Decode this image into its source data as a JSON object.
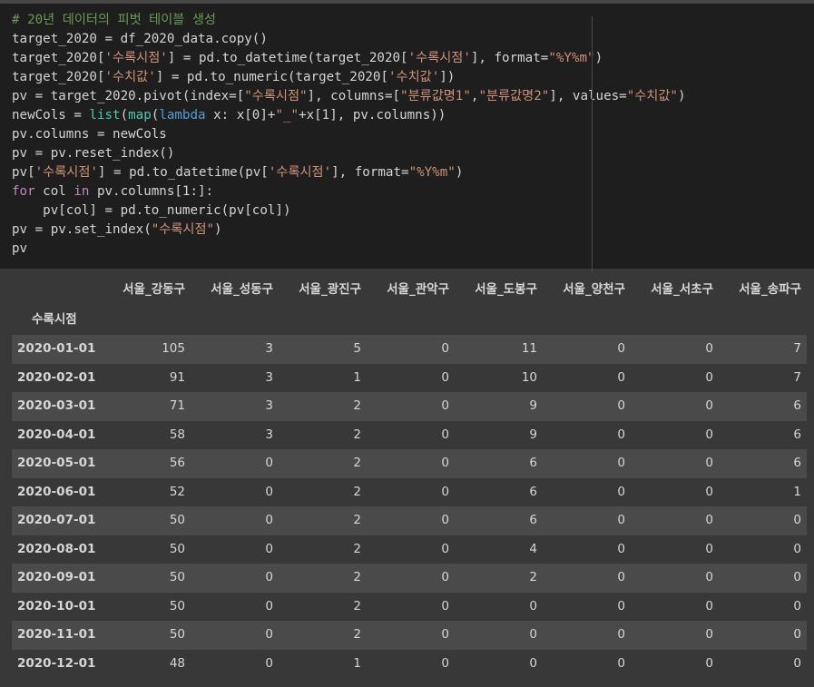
{
  "code_cell": {
    "lines": [
      [
        {
          "t": "# 20년 데이터의 피벗 테이블 생성",
          "c": "c-comment"
        }
      ],
      [
        {
          "t": "target_2020 = df_2020_data.copy()",
          "c": ""
        }
      ],
      [
        {
          "t": "target_2020[",
          "c": ""
        },
        {
          "t": "'수록시점'",
          "c": "c-str"
        },
        {
          "t": "] = pd.to_datetime(target_2020[",
          "c": ""
        },
        {
          "t": "'수록시점'",
          "c": "c-str"
        },
        {
          "t": "], format=",
          "c": ""
        },
        {
          "t": "\"%Y%m\"",
          "c": "c-str"
        },
        {
          "t": ")",
          "c": ""
        }
      ],
      [
        {
          "t": "target_2020[",
          "c": ""
        },
        {
          "t": "'수치값'",
          "c": "c-str"
        },
        {
          "t": "] = pd.to_numeric(target_2020[",
          "c": ""
        },
        {
          "t": "'수치값'",
          "c": "c-str"
        },
        {
          "t": "])",
          "c": ""
        }
      ],
      [
        {
          "t": "pv = target_2020.pivot(index=[",
          "c": ""
        },
        {
          "t": "\"수록시점\"",
          "c": "c-str"
        },
        {
          "t": "], columns=[",
          "c": ""
        },
        {
          "t": "\"분류값명1\"",
          "c": "c-str"
        },
        {
          "t": ",",
          "c": ""
        },
        {
          "t": "\"분류값명2\"",
          "c": "c-str"
        },
        {
          "t": "], values=",
          "c": ""
        },
        {
          "t": "\"수치값\"",
          "c": "c-str"
        },
        {
          "t": ")",
          "c": ""
        }
      ],
      [
        {
          "t": "newCols = ",
          "c": ""
        },
        {
          "t": "list",
          "c": "c-builtin"
        },
        {
          "t": "(",
          "c": ""
        },
        {
          "t": "map",
          "c": "c-builtin"
        },
        {
          "t": "(",
          "c": ""
        },
        {
          "t": "lambda",
          "c": "c-lambda"
        },
        {
          "t": " x: x[0]+",
          "c": ""
        },
        {
          "t": "\"_\"",
          "c": "c-str"
        },
        {
          "t": "+x[1], pv.columns))",
          "c": ""
        }
      ],
      [
        {
          "t": "pv.columns = newCols",
          "c": ""
        }
      ],
      [
        {
          "t": "pv = pv.reset_index()",
          "c": ""
        }
      ],
      [
        {
          "t": "pv[",
          "c": ""
        },
        {
          "t": "'수록시점'",
          "c": "c-str"
        },
        {
          "t": "] = pd.to_datetime(pv[",
          "c": ""
        },
        {
          "t": "'수록시점'",
          "c": "c-str"
        },
        {
          "t": "], format=",
          "c": ""
        },
        {
          "t": "\"%Y%m\"",
          "c": "c-str"
        },
        {
          "t": ")",
          "c": ""
        }
      ],
      [
        {
          "t": "for",
          "c": "c-kw"
        },
        {
          "t": " col ",
          "c": ""
        },
        {
          "t": "in",
          "c": "c-kw"
        },
        {
          "t": " pv.columns[1:]:",
          "c": ""
        }
      ],
      [
        {
          "t": "    pv[col] = pd.to_numeric(pv[col])",
          "c": ""
        }
      ],
      [
        {
          "t": "pv = pv.set_index(",
          "c": ""
        },
        {
          "t": "\"수록시점\"",
          "c": "c-str"
        },
        {
          "t": ")",
          "c": ""
        }
      ],
      [
        {
          "t": "pv",
          "c": ""
        }
      ]
    ]
  },
  "output_table": {
    "index_name": "수록시점",
    "columns": [
      "서울_강동구",
      "서울_성동구",
      "서울_광진구",
      "서울_관악구",
      "서울_도봉구",
      "서울_양천구",
      "서울_서초구",
      "서울_송파구"
    ],
    "rows": [
      {
        "index": "2020-01-01",
        "values": [
          "105",
          "3",
          "5",
          "0",
          "11",
          "0",
          "0",
          "7"
        ]
      },
      {
        "index": "2020-02-01",
        "values": [
          "91",
          "3",
          "1",
          "0",
          "10",
          "0",
          "0",
          "7"
        ]
      },
      {
        "index": "2020-03-01",
        "values": [
          "71",
          "3",
          "2",
          "0",
          "9",
          "0",
          "0",
          "6"
        ]
      },
      {
        "index": "2020-04-01",
        "values": [
          "58",
          "3",
          "2",
          "0",
          "9",
          "0",
          "0",
          "6"
        ]
      },
      {
        "index": "2020-05-01",
        "values": [
          "56",
          "0",
          "2",
          "0",
          "6",
          "0",
          "0",
          "6"
        ]
      },
      {
        "index": "2020-06-01",
        "values": [
          "52",
          "0",
          "2",
          "0",
          "6",
          "0",
          "0",
          "1"
        ]
      },
      {
        "index": "2020-07-01",
        "values": [
          "50",
          "0",
          "2",
          "0",
          "6",
          "0",
          "0",
          "0"
        ]
      },
      {
        "index": "2020-08-01",
        "values": [
          "50",
          "0",
          "2",
          "0",
          "4",
          "0",
          "0",
          "0"
        ]
      },
      {
        "index": "2020-09-01",
        "values": [
          "50",
          "0",
          "2",
          "0",
          "2",
          "0",
          "0",
          "0"
        ]
      },
      {
        "index": "2020-10-01",
        "values": [
          "50",
          "0",
          "2",
          "0",
          "0",
          "0",
          "0",
          "0"
        ]
      },
      {
        "index": "2020-11-01",
        "values": [
          "50",
          "0",
          "2",
          "0",
          "0",
          "0",
          "0",
          "0"
        ]
      },
      {
        "index": "2020-12-01",
        "values": [
          "48",
          "0",
          "1",
          "0",
          "0",
          "0",
          "0",
          "0"
        ]
      }
    ]
  },
  "colors": {
    "code_background": "#1e1e1e",
    "output_background": "#383838",
    "striped_row": "#4a4a4a",
    "comment": "#6a9955",
    "string": "#ce9178",
    "keyword": "#c586c0",
    "builtin": "#4ec9b0"
  }
}
